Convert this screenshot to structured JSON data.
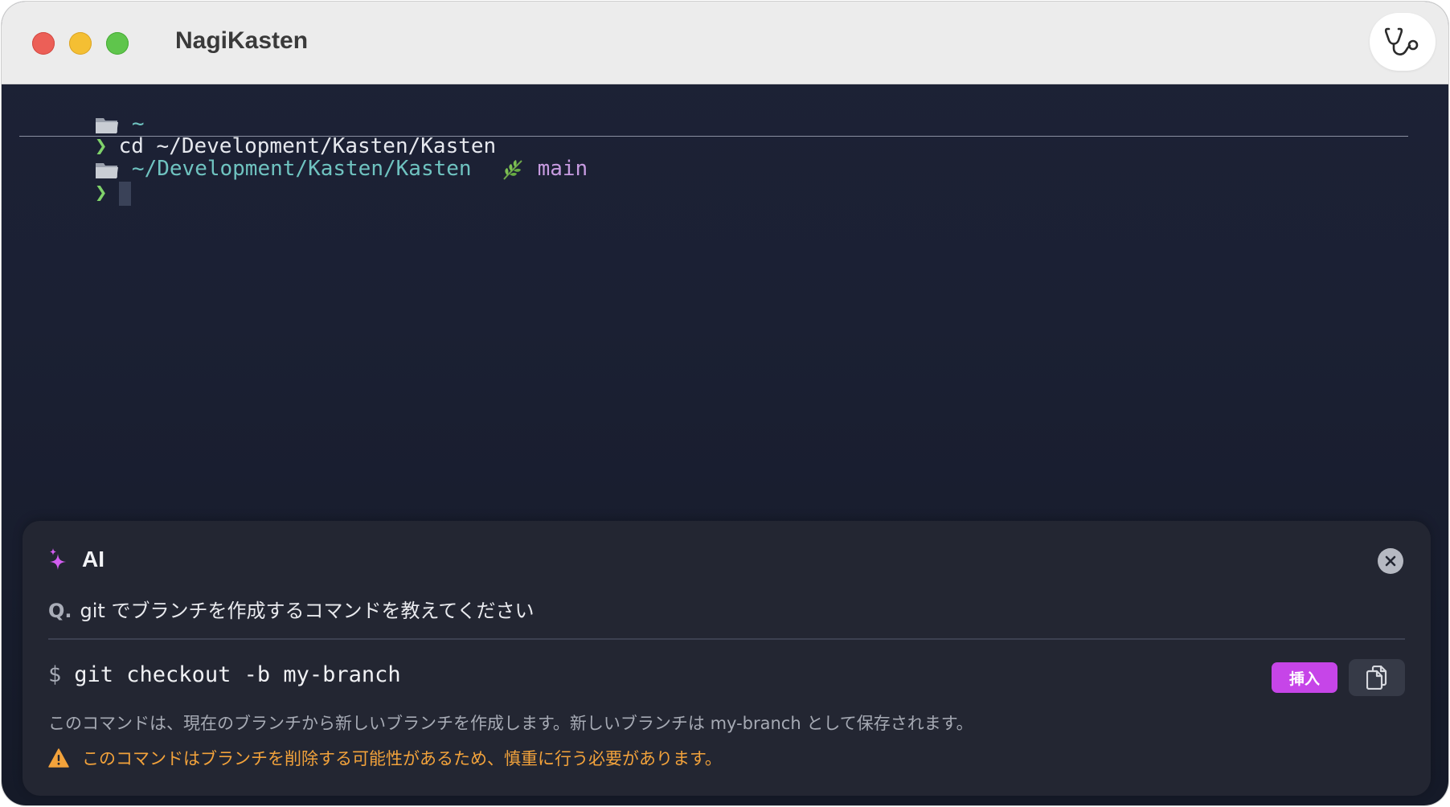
{
  "window": {
    "title": "NagiKasten"
  },
  "terminal": {
    "lines": [
      {
        "folder_path": "~"
      },
      {
        "prompt": "❯",
        "command": "cd ~/Development/Kasten/Kasten"
      },
      {
        "folder_path": "~/Development/Kasten/Kasten",
        "branch": "main"
      },
      {
        "prompt": "❯"
      }
    ]
  },
  "ai_panel": {
    "label": "AI",
    "question_prefix": "Q.",
    "question": "git でブランチを作成するコマンドを教えてください",
    "command_prefix": "$",
    "command": "git checkout -b my-branch",
    "insert_label": "挿入",
    "description": "このコマンドは、現在のブランチから新しいブランチを作成します。新しいブランチは my-branch として保存されます。",
    "warning": "このコマンドはブランチを削除する可能性があるため、慎重に行う必要があります。"
  },
  "colors": {
    "accent": "#c645e8",
    "warning": "#f2a23b",
    "path": "#6fc3c0",
    "branch": "#c79be0",
    "prompt": "#7fd26a"
  },
  "icons": {
    "folder": "folder-icon",
    "branch": "leaf-icon",
    "ai": "sparkles-icon",
    "close": "close-icon",
    "copy": "copy-icon",
    "warning": "warning-icon",
    "doctor": "stethoscope-icon"
  }
}
